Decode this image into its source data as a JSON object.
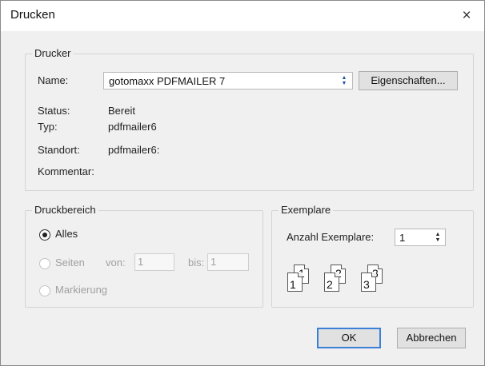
{
  "window": {
    "title": "Drucken",
    "close_icon": "×"
  },
  "printer": {
    "group_label": "Drucker",
    "name_label": "Name:",
    "name_value": "gotomaxx PDFMAILER 7",
    "properties_button": "Eigenschaften...",
    "status_label": "Status:",
    "status_value": "Bereit",
    "type_label": "Typ:",
    "type_value": "pdfmailer6",
    "location_label": "Standort:",
    "location_value": "pdfmailer6:",
    "comment_label": "Kommentar:",
    "comment_value": ""
  },
  "range": {
    "group_label": "Druckbereich",
    "all_label": "Alles",
    "pages_label": "Seiten",
    "from_label": "von:",
    "from_value": "1",
    "to_label": "bis:",
    "to_value": "1",
    "selection_label": "Markierung",
    "selected": "all"
  },
  "copies": {
    "group_label": "Exemplare",
    "count_label": "Anzahl Exemplare:",
    "count_value": "1",
    "collate_pages": [
      {
        "back": "1",
        "front": "1"
      },
      {
        "back": "2",
        "front": "2"
      },
      {
        "back": "3",
        "front": "3"
      }
    ]
  },
  "buttons": {
    "ok": "OK",
    "cancel": "Abbrechen"
  },
  "colors": {
    "accent": "#3c7fd8",
    "dialog_bg": "#f0f0f0",
    "disabled_text": "#a0a0a0"
  }
}
